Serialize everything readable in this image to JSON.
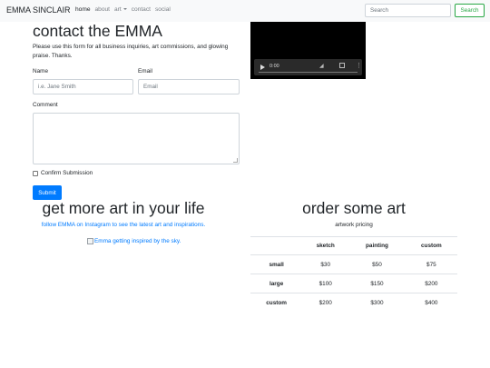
{
  "navbar": {
    "brand": "EMMA SINCLAIR",
    "links": [
      "home",
      "about",
      "art",
      "contact",
      "social"
    ],
    "search_placeholder": "Search",
    "search_button": "Search"
  },
  "contact": {
    "title": "contact the EMMA",
    "intro": "Please use this form for all business inquiries, art commissions, and glowing praise. Thanks.",
    "name_label": "Name",
    "name_placeholder": "i.e. Jane Smith",
    "email_label": "Email",
    "email_placeholder": "Email",
    "comment_label": "Comment",
    "confirm_label": "Confirm Submission",
    "submit_label": "Submit"
  },
  "video": {
    "time": "0:00"
  },
  "art": {
    "title": "get more art in your life",
    "instagram_link": "follow EMMA on Instagram to see the latest art and inspirations.",
    "image_alt": "Emma getting inspired by the sky."
  },
  "order": {
    "title": "order some art",
    "subtitle": "artwork pricing",
    "columns": [
      "",
      "sketch",
      "painting",
      "custom"
    ],
    "rows": [
      {
        "size": "small",
        "prices": [
          "$30",
          "$50",
          "$75"
        ]
      },
      {
        "size": "large",
        "prices": [
          "$100",
          "$150",
          "$200"
        ]
      },
      {
        "size": "custom",
        "prices": [
          "$200",
          "$300",
          "$400"
        ]
      }
    ]
  },
  "colors": {
    "primary": "#007bff",
    "success": "#28a745",
    "navbar_bg": "#f8f9fa"
  }
}
